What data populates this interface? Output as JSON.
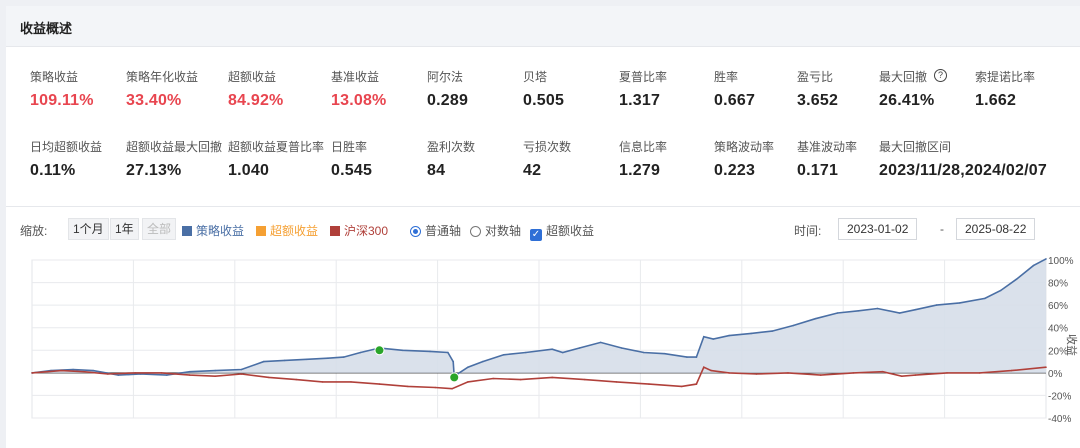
{
  "header": {
    "title": "收益概述"
  },
  "metrics": [
    {
      "label": "策略收益",
      "value": "109.11%",
      "red": true
    },
    {
      "label": "策略年化收益",
      "value": "33.40%",
      "red": true
    },
    {
      "label": "超额收益",
      "value": "84.92%",
      "red": true
    },
    {
      "label": "基准收益",
      "value": "13.08%",
      "red": true
    },
    {
      "label": "阿尔法",
      "value": "0.289"
    },
    {
      "label": "贝塔",
      "value": "0.505"
    },
    {
      "label": "夏普比率",
      "value": "1.317"
    },
    {
      "label": "胜率",
      "value": "0.667"
    },
    {
      "label": "盈亏比",
      "value": "3.652"
    },
    {
      "label": "最大回撤",
      "value": "26.41%",
      "help_icon": "question-circle-icon"
    },
    {
      "label": "索提诺比率",
      "value": "1.662"
    },
    {
      "label": "日均超额收益",
      "value": "0.11%"
    },
    {
      "label": "超额收益最大回撤",
      "value": "27.13%"
    },
    {
      "label": "超额收益夏普比率",
      "value": "1.040"
    },
    {
      "label": "日胜率",
      "value": "0.545"
    },
    {
      "label": "盈利次数",
      "value": "84"
    },
    {
      "label": "亏损次数",
      "value": "42"
    },
    {
      "label": "信息比率",
      "value": "1.279"
    },
    {
      "label": "策略波动率",
      "value": "0.223"
    },
    {
      "label": "基准波动率",
      "value": "0.171"
    },
    {
      "label": "最大回撤区间",
      "value": "2023/11/28,2024/02/07"
    }
  ],
  "toolbar": {
    "zoom_label": "缩放:",
    "zoom_buttons": [
      "1个月",
      "1年",
      "全部"
    ],
    "legend": [
      {
        "label": "策略收益",
        "color": "#4a6fa5"
      },
      {
        "label": "超额收益",
        "color": "#f5a033"
      },
      {
        "label": "沪深300",
        "color": "#b0403a"
      }
    ],
    "axis_options": [
      "普通轴",
      "对数轴"
    ],
    "axis_selected": "普通轴",
    "excess_checkbox_label": "超额收益",
    "excess_checked": true,
    "time_label": "时间:",
    "date_from": "2023-01-02",
    "date_sep": "-",
    "date_to": "2025-08-22"
  },
  "chart_data": {
    "type": "line",
    "ylim": [
      -40,
      100
    ],
    "y_ticks": [
      "100%",
      "80%",
      "60%",
      "40%",
      "20%",
      "0%",
      "-20%",
      "-40%"
    ],
    "y_tick_values": [
      100,
      80,
      60,
      40,
      20,
      0,
      -20,
      -40
    ],
    "ylabel": "收益",
    "grid": true,
    "x_range": [
      "2023-01-02",
      "2025-08-22"
    ],
    "series": [
      {
        "name": "策略收益",
        "color": "#4a6fa5",
        "fill": "#d6dee9",
        "x": [
          "2023-01-02",
          "2023-01-20",
          "2023-02-10",
          "2023-03-01",
          "2023-03-25",
          "2023-04-15",
          "2023-05-10",
          "2023-06-01",
          "2023-06-25",
          "2023-07-20",
          "2023-08-10",
          "2023-08-30",
          "2023-09-20",
          "2023-10-10",
          "2023-10-25",
          "2023-11-10",
          "2023-11-28",
          "2023-12-20",
          "2024-01-15",
          "2024-02-01",
          "2024-02-06",
          "2024-02-07",
          "2024-02-20",
          "2024-03-05",
          "2024-03-25",
          "2024-04-15",
          "2024-05-10",
          "2024-05-20",
          "2024-06-05",
          "2024-06-25",
          "2024-07-15",
          "2024-08-05",
          "2024-08-25",
          "2024-09-15",
          "2024-09-24",
          "2024-10-01",
          "2024-10-10",
          "2024-10-25",
          "2024-11-15",
          "2024-12-05",
          "2024-12-25",
          "2025-01-15",
          "2025-02-05",
          "2025-02-25",
          "2025-03-15",
          "2025-04-05",
          "2025-04-20",
          "2025-05-10",
          "2025-06-01",
          "2025-06-25",
          "2025-07-10",
          "2025-07-25",
          "2025-08-10",
          "2025-08-22"
        ],
        "values": [
          0,
          2,
          3,
          2,
          -2,
          -1,
          -2,
          1,
          2,
          3,
          10,
          11,
          12,
          13,
          14,
          18,
          22,
          20,
          19,
          18,
          10,
          -3,
          5,
          10,
          16,
          18,
          21,
          18,
          22,
          27,
          22,
          18,
          17,
          14,
          14,
          32,
          30,
          33,
          35,
          37,
          42,
          48,
          53,
          55,
          57,
          53,
          56,
          60,
          62,
          66,
          73,
          83,
          95,
          101
        ]
      },
      {
        "name": "沪深300",
        "color": "#b0403a",
        "x": [
          "2023-01-02",
          "2023-01-30",
          "2023-02-20",
          "2023-03-15",
          "2023-04-10",
          "2023-05-05",
          "2023-06-01",
          "2023-06-25",
          "2023-07-20",
          "2023-08-15",
          "2023-09-10",
          "2023-10-05",
          "2023-11-01",
          "2023-11-28",
          "2023-12-25",
          "2024-01-20",
          "2024-02-05",
          "2024-02-20",
          "2024-03-15",
          "2024-04-10",
          "2024-05-10",
          "2024-06-10",
          "2024-07-10",
          "2024-08-10",
          "2024-09-10",
          "2024-09-24",
          "2024-10-01",
          "2024-10-08",
          "2024-10-25",
          "2024-11-20",
          "2024-12-20",
          "2025-01-20",
          "2025-02-20",
          "2025-03-20",
          "2025-04-07",
          "2025-04-20",
          "2025-05-20",
          "2025-06-20",
          "2025-07-20",
          "2025-08-22"
        ],
        "values": [
          0,
          2,
          1,
          -1,
          0,
          0,
          -2,
          -3,
          -1,
          -4,
          -6,
          -8,
          -8,
          -10,
          -12,
          -13,
          -14,
          -8,
          -5,
          -6,
          -4,
          -6,
          -8,
          -10,
          -12,
          -10,
          5,
          2,
          0,
          -1,
          0,
          -2,
          0,
          1,
          -3,
          -2,
          0,
          0,
          2,
          5
        ]
      }
    ],
    "markers": [
      {
        "x": "2023-11-28",
        "y": 20,
        "color": "#2aa52a"
      },
      {
        "x": "2024-02-07",
        "y": -4,
        "color": "#2aa52a"
      }
    ]
  }
}
